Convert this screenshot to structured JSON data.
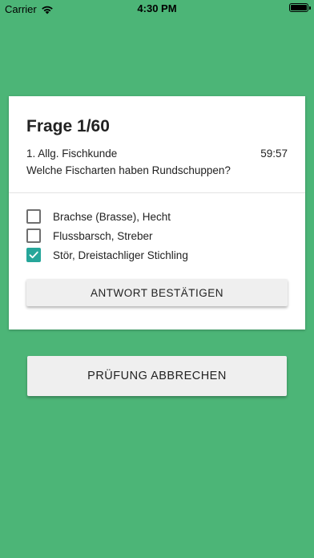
{
  "status_bar": {
    "carrier": "Carrier",
    "time": "4:30 PM",
    "wifi_icon": "wifi-icon",
    "battery_icon": "battery-icon"
  },
  "question": {
    "title": "Frage 1/60",
    "category": "1. Allg. Fischkunde",
    "timer": "59:57",
    "text": "Welche Fischarten haben Rundschuppen?"
  },
  "answers": [
    {
      "label": "Brachse (Brasse), Hecht",
      "checked": false
    },
    {
      "label": "Flussbarsch, Streber",
      "checked": false
    },
    {
      "label": "Stör, Dreistachliger Stichling",
      "checked": true
    }
  ],
  "buttons": {
    "confirm_label": "ANTWORT BESTÄTIGEN",
    "abort_label": "PRÜFUNG ABBRECHEN"
  },
  "colors": {
    "background": "#4cb577",
    "checkbox_checked": "#26a69a",
    "button_bg": "#efefef"
  }
}
